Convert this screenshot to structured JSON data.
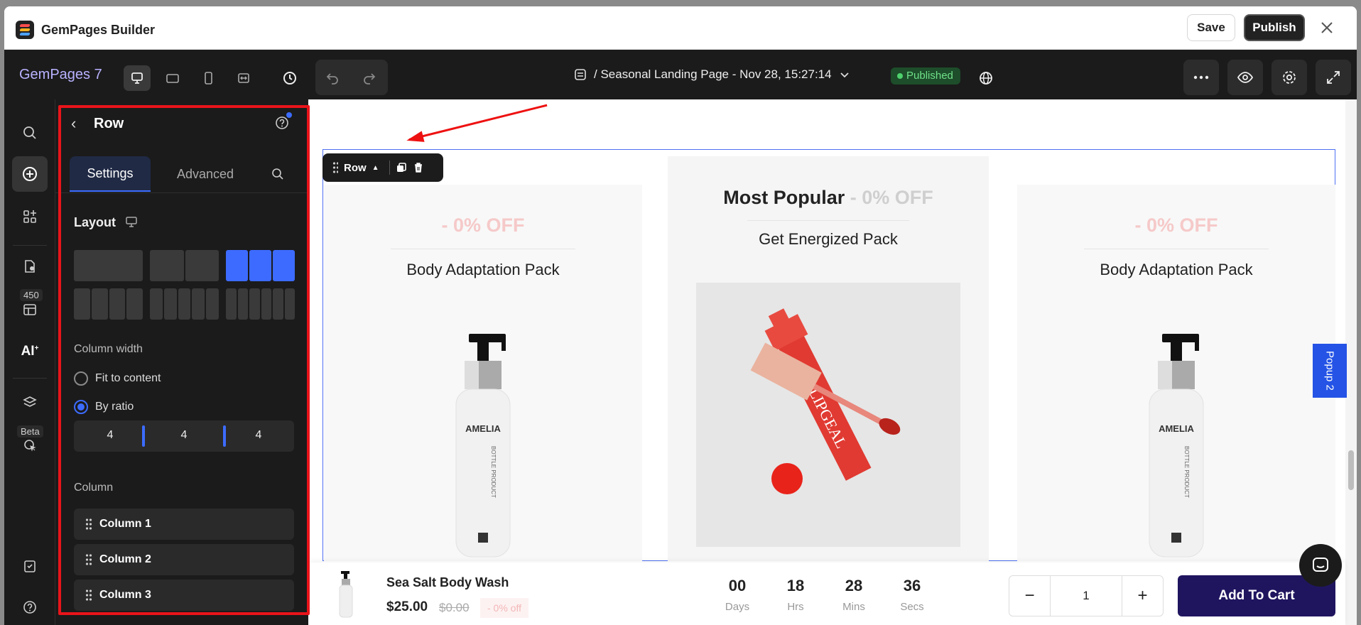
{
  "window": {
    "title": "GemPages Builder",
    "save_label": "Save",
    "publish_label": "Publish"
  },
  "toolbar": {
    "brand": "GemPages 7",
    "page_name": "/ Seasonal Landing Page - Nov 28, 15:27:14",
    "status": "Published"
  },
  "leftbar": {
    "badge_count": "450",
    "ai_label": "AI",
    "beta_label": "Beta"
  },
  "panel": {
    "title": "Row",
    "tabs": [
      "Settings",
      "Advanced"
    ],
    "layout_label": "Layout",
    "column_width_label": "Column width",
    "options": [
      "Fit to content",
      "By ratio"
    ],
    "selected_option": "By ratio",
    "ratios": [
      "4",
      "4",
      "4"
    ],
    "column_label": "Column",
    "columns": [
      "Column 1",
      "Column 2",
      "Column 3"
    ]
  },
  "canvas": {
    "row_label": "Row",
    "popup_label": "Popup 2",
    "cards": [
      {
        "off": "- 0% OFF",
        "name": "Body Adaptation Pack"
      },
      {
        "popular": "Most Popular",
        "off": "- 0% OFF",
        "name": "Get Energized Pack"
      },
      {
        "off": "- 0% OFF",
        "name": "Body Adaptation Pack"
      }
    ],
    "bottle_brand": "AMELIA",
    "bottle_sub": "BOTTLE PRODUCT",
    "lipgloss_brand": "LIPGEAL"
  },
  "sticky": {
    "name": "Sea Salt Body Wash",
    "price": "$25.00",
    "compare": "$0.00",
    "discount": "- 0% off",
    "countdown": [
      {
        "value": "00",
        "unit": "Days"
      },
      {
        "value": "18",
        "unit": "Hrs"
      },
      {
        "value": "28",
        "unit": "Mins"
      },
      {
        "value": "36",
        "unit": "Secs"
      }
    ],
    "qty_minus": "−",
    "qty": "1",
    "qty_plus": "+",
    "cta": "Add To Cart"
  }
}
